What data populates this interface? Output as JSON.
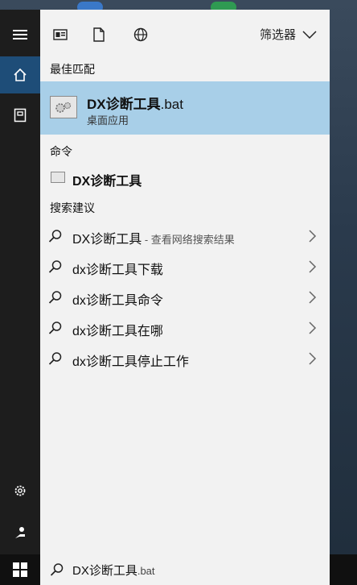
{
  "toolbar": {
    "filter_label": "筛选器"
  },
  "best_match": {
    "section_title": "最佳匹配",
    "title_main": "DX诊断工具",
    "title_ext": ".bat",
    "subtitle": "桌面应用"
  },
  "commands": {
    "section_title": "命令",
    "item_label": "DX诊断工具"
  },
  "suggestions": {
    "section_title": "搜索建议",
    "items": [
      {
        "text": "DX诊断工具",
        "hint": " - 查看网络搜索结果"
      },
      {
        "text": "dx诊断工具下载",
        "hint": ""
      },
      {
        "text": "dx诊断工具命令",
        "hint": ""
      },
      {
        "text": "dx诊断工具在哪",
        "hint": ""
      },
      {
        "text": "dx诊断工具停止工作",
        "hint": ""
      }
    ]
  },
  "search_box": {
    "query_main": "DX诊断工具",
    "query_ext": ".bat"
  },
  "colors": {
    "selected_bg": "#a8cfe8",
    "rail_active": "#1e4d78",
    "panel_bg": "#f2f2f2"
  }
}
